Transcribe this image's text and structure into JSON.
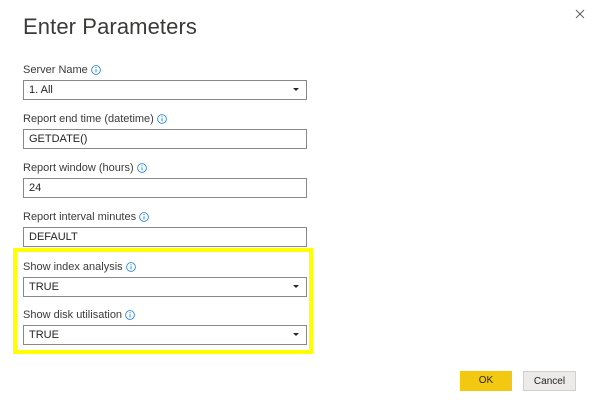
{
  "dialog": {
    "title": "Enter Parameters"
  },
  "fields": [
    {
      "label": "Server Name",
      "type": "select",
      "value": "1. All"
    },
    {
      "label": "Report end time (datetime)",
      "type": "text",
      "value": "GETDATE()"
    },
    {
      "label": "Report window (hours)",
      "type": "text",
      "value": "24"
    },
    {
      "label": "Report interval minutes",
      "type": "text",
      "value": "DEFAULT"
    },
    {
      "label": "Show index analysis",
      "type": "select",
      "value": "TRUE"
    },
    {
      "label": "Show disk utilisation",
      "type": "select",
      "value": "TRUE"
    }
  ],
  "buttons": {
    "ok": "OK",
    "cancel": "Cancel"
  },
  "colors": {
    "highlight": "#ffff00",
    "ok_button": "#f2c811",
    "info_icon": "#2b88d8"
  },
  "icons": {
    "close": "close-icon",
    "info": "info-icon",
    "dropdown": "chevron-down-icon"
  }
}
